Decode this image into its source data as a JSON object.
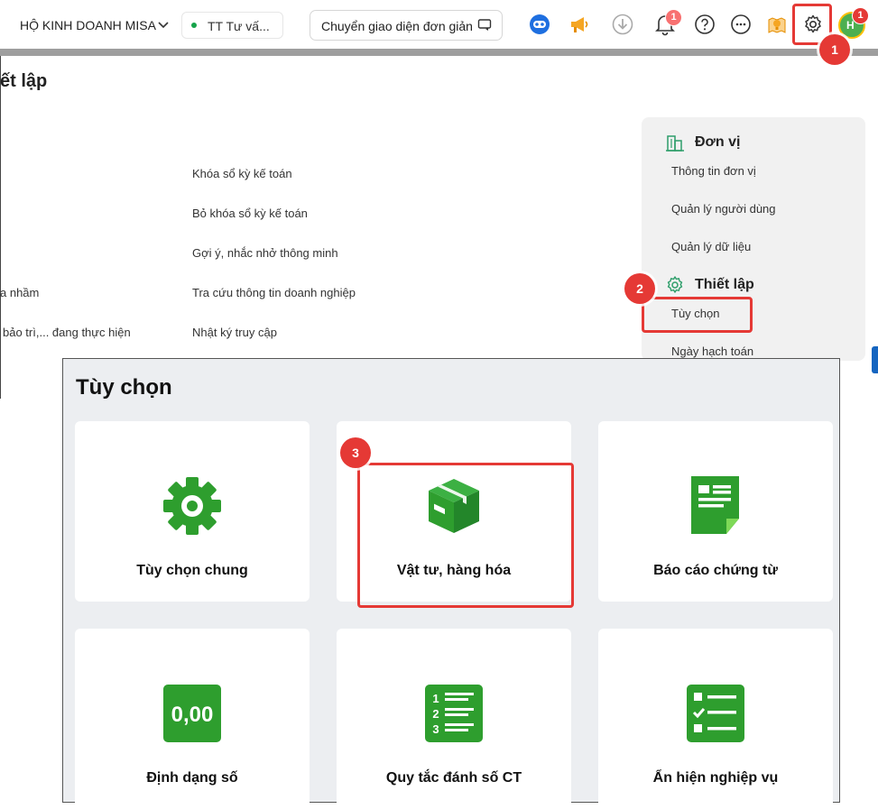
{
  "header": {
    "company": "HỘ KINH DOANH MISA",
    "branch": "TT Tư vấ...",
    "simple_ui_button": "Chuyển giao diện đơn giản",
    "notification_count": "1",
    "avatar_initials": "H",
    "avatar_badge": "1"
  },
  "page": {
    "title": "ết lập",
    "links_left": [
      "a nhầm",
      "bảo trì,... đang thực hiện"
    ],
    "links_mid": [
      "Khóa sổ kỳ kế toán",
      "Bỏ khóa sổ kỳ kế toán",
      "Gợi ý, nhắc nhở thông minh",
      "Tra cứu thông tin doanh nghiệp",
      "Nhật ký truy cập"
    ]
  },
  "sidebar": {
    "section1": {
      "title": "Đơn vị",
      "items": [
        "Thông tin đơn vị",
        "Quản lý người dùng",
        "Quản lý dữ liệu"
      ]
    },
    "section2": {
      "title": "Thiết lập",
      "items": [
        "Tùy chọn",
        "Ngày hạch toán"
      ]
    }
  },
  "steps": [
    "1",
    "2",
    "3"
  ],
  "dialog": {
    "title": "Tùy chọn",
    "cards": [
      {
        "label": "Tùy chọn chung",
        "icon": "gear-icon"
      },
      {
        "label": "Vật tư, hàng hóa",
        "icon": "box-icon"
      },
      {
        "label": "Báo cáo chứng từ",
        "icon": "document-icon"
      },
      {
        "label": "Định dạng số",
        "icon": "number-format-icon",
        "icon_text": "0,00"
      },
      {
        "label": "Quy tắc đánh số CT",
        "icon": "numbered-list-icon"
      },
      {
        "label": "Ẩn hiện nghiệp vụ",
        "icon": "checklist-icon"
      }
    ]
  },
  "colors": {
    "accent_green": "#2e9e2e",
    "highlight_red": "#e53935",
    "gray_bar": "#9e9e9e"
  }
}
